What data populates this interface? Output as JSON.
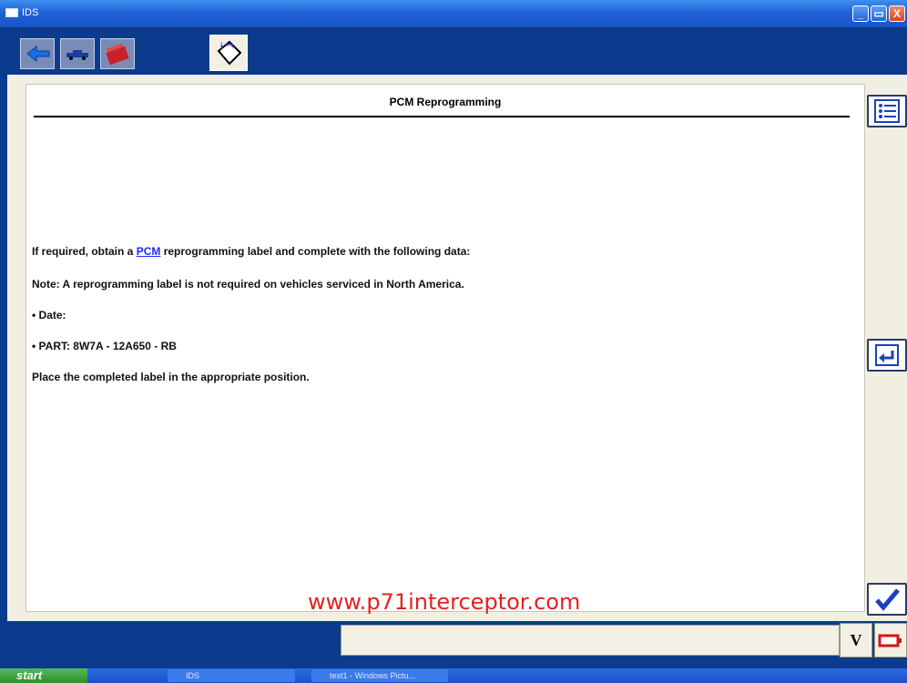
{
  "window": {
    "title": "IDS",
    "minimize": "_",
    "maximize": "▭",
    "close": "X"
  },
  "page": {
    "title": "PCM Reprogramming",
    "line1_before": "If required, obtain a ",
    "line1_link": "PCM",
    "line1_after": " reprogramming label and complete with the following data:",
    "note": "Note: A reprogramming label is not required on vehicles serviced in North America.",
    "date": "• Date:",
    "part": "• PART: 8W7A - 12A650 - RB",
    "place": "Place the completed label in the appropriate position.",
    "watermark": "www.p71interceptor.com"
  },
  "status": {
    "v_label": "V"
  },
  "taskbar": {
    "start_label": "start",
    "items": [
      "IDS",
      "test1 - Windows Pictu..."
    ]
  },
  "icons": {
    "toolbar": [
      "back-arrow-icon",
      "vehicle-icon",
      "toolbox-icon",
      "info-page-icon"
    ],
    "side": [
      "list-icon",
      "return-icon",
      "checkmark-icon"
    ],
    "status": [
      "vehicle-battery-icon",
      "battery-icon"
    ]
  },
  "colors": {
    "accent": "#0b3b8d",
    "link": "#1a2bff",
    "watermark": "#e5201e"
  }
}
